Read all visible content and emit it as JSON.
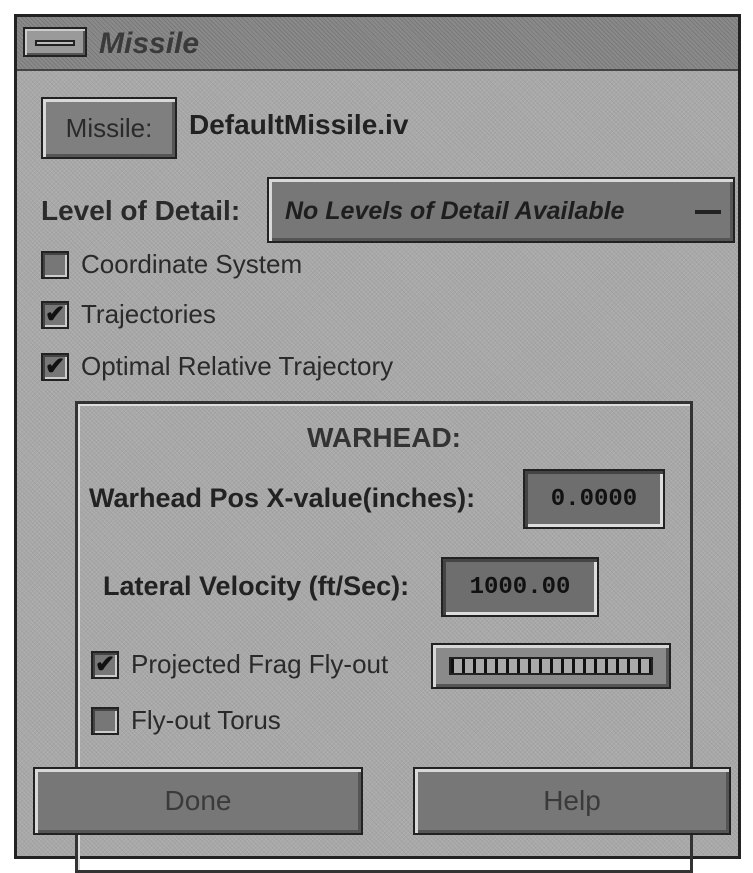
{
  "window": {
    "title": "Missile"
  },
  "missile": {
    "button_label": "Missile:",
    "file": "DefaultMissile.iv"
  },
  "lod": {
    "label": "Level of Detail:",
    "value": "No Levels of Detail Available"
  },
  "options": [
    {
      "label": "Coordinate System",
      "checked": false
    },
    {
      "label": "Trajectories",
      "checked": true
    },
    {
      "label": "Optimal Relative Trajectory",
      "checked": true
    }
  ],
  "warhead": {
    "title": "WARHEAD:",
    "pos_x_label": "Warhead Pos X-value(inches):",
    "pos_x_value": "0.0000",
    "lat_vel_label": "Lateral Velocity (ft/Sec):",
    "lat_vel_value": "1000.00",
    "options": [
      {
        "label": "Projected Frag Fly-out",
        "checked": true
      },
      {
        "label": "Fly-out Torus",
        "checked": false
      }
    ]
  },
  "buttons": {
    "done": "Done",
    "help": "Help"
  },
  "colors": {
    "panel": "#a9a9a9",
    "field": "#6e6e6e"
  },
  "checkmark_glyph": "✔"
}
